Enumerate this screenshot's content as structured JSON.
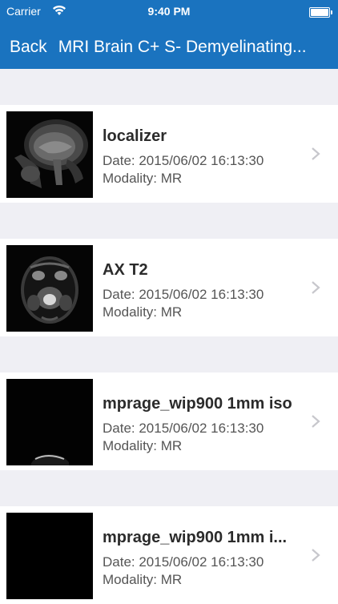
{
  "status_bar": {
    "carrier": "Carrier",
    "time": "9:40 PM"
  },
  "nav": {
    "back_label": "Back",
    "title": "MRI Brain C+ S- Demyelinating..."
  },
  "series": [
    {
      "title": "localizer",
      "date": "Date: 2015/06/02 16:13:30",
      "modality": "Modality: MR"
    },
    {
      "title": "AX T2",
      "date": "Date: 2015/06/02 16:13:30",
      "modality": "Modality: MR"
    },
    {
      "title": "mprage_wip900 1mm iso",
      "date": "Date: 2015/06/02 16:13:30",
      "modality": "Modality: MR"
    },
    {
      "title": "mprage_wip900 1mm i...",
      "date": "Date: 2015/06/02 16:13:30",
      "modality": "Modality: MR"
    }
  ],
  "colors": {
    "nav_bar": "#1a73bf",
    "background": "#efeff4"
  }
}
